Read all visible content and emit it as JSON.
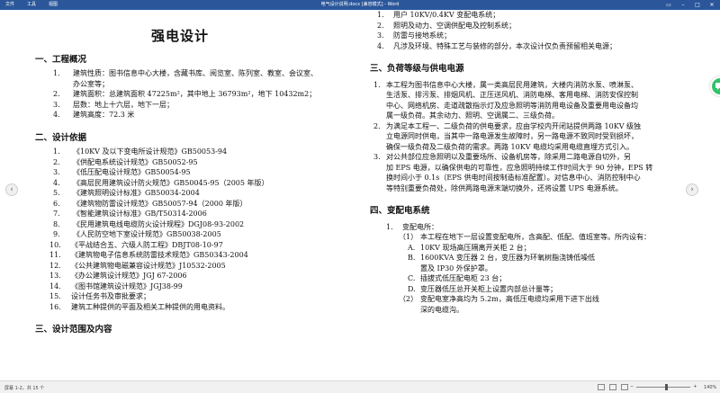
{
  "titlebar": {
    "menu": [
      "文件",
      "工具",
      "视图"
    ],
    "title": "电气设计说明.docx [兼容模式] - Word"
  },
  "left": {
    "title": "强电设计",
    "sec1": {
      "heading": "一、工程概况",
      "items": [
        [
          "1.",
          "建筑性质：图书信息中心大楼，含藏书库、阅览室、陈列室、教室、会议室、"
        ],
        [
          "",
          "办公室等；"
        ],
        [
          "2.",
          "建筑面积：总建筑面积 47225m²，其中地上 36793m²，地下 10432m2；"
        ],
        [
          "3.",
          "层数：地上十六层，地下一层；"
        ],
        [
          "4.",
          "建筑高度：72.3 米"
        ]
      ]
    },
    "sec2": {
      "heading": "二、设计依据",
      "items": [
        [
          "1.",
          "《10KV 及以下变电所设计规范》GB50053-94"
        ],
        [
          "2.",
          "《供配电系统设计规范》GB50052-95"
        ],
        [
          "3.",
          "《低压配电设计规范》GB50054-95"
        ],
        [
          "4.",
          "《高层民用建筑设计防火规范》GB50045-95（2005 年版）"
        ],
        [
          "5.",
          "《建筑照明设计标准》GB50034-2004"
        ],
        [
          "6.",
          "《建筑物防雷设计规范》GB50057-94（2000 年版）"
        ],
        [
          "7.",
          "《智能建筑设计标准》GB/T50314-2006"
        ],
        [
          "8.",
          "《民用建筑电线电缆防火设计规程》DGJ08-93-2002"
        ],
        [
          "9.",
          "《人民防空地下室设计规范》GB50038-2005"
        ],
        [
          "10.",
          "《平战结合五、六级人防工程》DBJT08-10-97"
        ],
        [
          "11.",
          "《建筑物电子信息系统防雷技术规范》GB50343-2004"
        ],
        [
          "12.",
          "《公共建筑物电磁兼容设计规范》J10532-2005"
        ],
        [
          "13.",
          "《办公建筑设计规范》JGJ 67-2006"
        ],
        [
          "14.",
          "《图书馆建筑设计规范》JGJ38-99"
        ],
        [
          "15.",
          "设计任务书及审批要求；"
        ],
        [
          "16.",
          "建筑工种提供的平面及相关工种提供的用电资料。"
        ]
      ]
    },
    "sec3": {
      "heading": "三、设计范围及内容"
    }
  },
  "right": {
    "scope_items": [
      [
        "1.",
        "用户 10KV/0.4KV 变配电系统；"
      ],
      [
        "2.",
        "照明及动力、空调供配电及控制系统；"
      ],
      [
        "3.",
        "防雷与接地系统；"
      ],
      [
        "4.",
        "凡涉及环境、特殊工艺与装修的部分，本次设计仅负责预留相关电源；"
      ]
    ],
    "sec3": {
      "heading": "三、负荷等级与供电电源",
      "p1": [
        "1.",
        "本工程为图书信息中心大楼，属一类高层民用建筑，大楼内消防水泵、喷淋泵、",
        "生活泵、排污泵、排烟风机、正压送风机、消防电梯、客用电梯、消防安保控制",
        "中心、网络机房、走道疏散指示灯及应急照明等消防用电设备及重要用电设备均",
        "属一级负荷。其余动力、照明、空调属二、三级负荷。"
      ],
      "p2": [
        "2.",
        "为满足本工程一、二级负荷的供电要求，应由学校内开闭站提供两路 10KV 级独",
        "立电源同时供电，当其中一路电源发生故障时，另一路电源不致同时受到损坏，",
        "确保一级负荷及二级负荷的需求。两路 10KV 电缆均采用电缆直埋方式引入。"
      ],
      "p3": [
        "3.",
        "对公共部位应急照明以及重要场所、设备机房等，除采用二路电源自切外，另",
        "加 EPS 电源，以确保供电的可靠性，应急照明持续工作时间大于 90 分钟，EPS 转",
        "换时间小于 0.1s（EPS 供电时间按制造标准配置）。对信息中心、消防控制中心",
        "等特别重要负荷处，除供两路电源末端切换外，还将设置 UPS 电源系统。"
      ]
    },
    "sec4": {
      "heading": "四、变配电系统",
      "s1": [
        "1.",
        "变配电所："
      ],
      "s1a": [
        "（1）",
        "本工程在地下一层设置变配电所，含高配、低配、值班室等。所内设有："
      ],
      "a": [
        "A.",
        "10KV 现场高压隔离开关柜 2 台；"
      ],
      "b": [
        "B.",
        "1600KVA 变压器 2 台，变压器为环氧树脂浇铸低噪低"
      ],
      "b2": "置及 IP30 外保护罩。",
      "c": [
        "C.",
        "插拔式低压配电柜 23 台；"
      ],
      "d": [
        "D.",
        "变压器低压总开关柜上设置内部总计量等；"
      ],
      "s1b": [
        "（2）",
        "变配电室净高均为 5.2m，高低压电缆均采用下进下出线"
      ],
      "s1b2": "深的电缆沟。"
    }
  },
  "statusbar": {
    "pages": "屏幕 1-2，共 15 个",
    "zoom": "140%"
  }
}
